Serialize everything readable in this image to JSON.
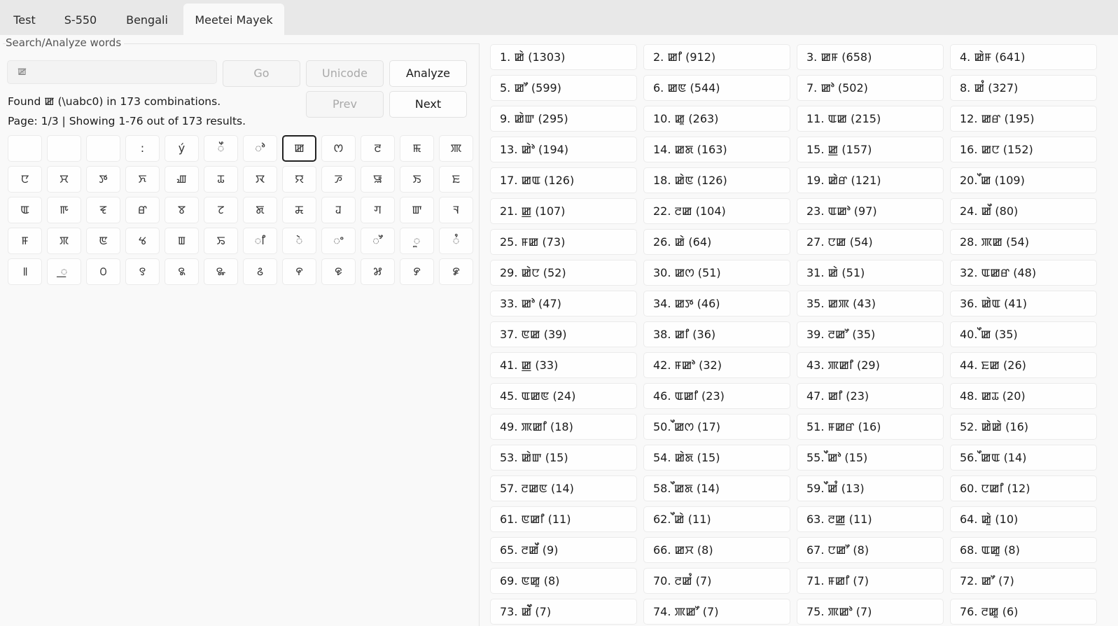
{
  "tabs": [
    {
      "label": "Test",
      "active": false
    },
    {
      "label": "S-550",
      "active": false
    },
    {
      "label": "Bengali",
      "active": false
    },
    {
      "label": "Meetei Mayek",
      "active": true
    }
  ],
  "panel": {
    "group_label": "Search/Analyze words",
    "search_value": "ꯀ",
    "go_label": "Go",
    "unicode_label": "Unicode",
    "analyze_label": "Analyze",
    "prev_label": "Prev",
    "next_label": "Next",
    "found_text": "Found ꯀ (\\uabc0) in 173 combinations.",
    "page_text": "Page: 1/3 | Showing 1-76 out of 173 results."
  },
  "keyboard": {
    "selected_index": 7,
    "keys": [
      "",
      "",
      "",
      ":",
      "ý",
      "ꯩ",
      "ꯣ",
      "ꯀ",
      "ꯁ",
      "ꯂ",
      "ꯃ",
      "ꯄ",
      "ꯅ",
      "ꯆ",
      "ꯇ",
      "ꯈ",
      "ꯉ",
      "ꯊ",
      "ꯋ",
      "ꯌ",
      "ꯍ",
      "ꯎ",
      "ꯏ",
      "ꯐ",
      "ꯑ",
      "ꯒ",
      "ꯓ",
      "ꯔ",
      "ꯕ",
      "ꯖ",
      "ꯗ",
      "ꯘ",
      "ꯙ",
      "ꯚ",
      "ꯛ",
      "ꯜ",
      "ꯝ",
      "ꯞ",
      "ꯟ",
      "ꯠ",
      "ꯡ",
      "ꯢ",
      "ꯤ",
      "ꯥ",
      "ꯦ",
      "ꯧ",
      "ꯨ",
      "ꯪ",
      "꯫",
      "꯭",
      "꯰",
      "꯱",
      "꯲",
      "꯳",
      "꯴",
      "꯵",
      "꯶",
      "꯷",
      "꯸",
      "꯹"
    ]
  },
  "results": [
    "1. ꯀꯥ (1303)",
    "2. ꯀꯤ (912)",
    "3. ꯀꯝ (658)",
    "4. ꯀꯥꯝ (641)",
    "5. ꯀꯧ (599)",
    "6. ꯀꯟ (544)",
    "7. ꯀꯣ (502)",
    "8. ꯀꯪ (327)",
    "9. ꯀꯥꯛ (295)",
    "10. ꯀꯨ (263)",
    "11. ꯑꯀ (215)",
    "12. ꯀꯔ (195)",
    "13. ꯀꯥꯣ (194)",
    "14. ꯀꯗ (163)",
    "15. ꯀ꯭ (157)",
    "16. ꯀꯅ (152)",
    "17. ꯀꯑ (126)",
    "18. ꯀꯥꯟ (126)",
    "19. ꯀꯥꯔ (121)",
    "20. ꯩꯀ (109)",
    "21. ꯀ꯭ (107)",
    "22. ꯂꯀ (104)",
    "23. ꯑꯀꯣ (97)",
    "24. ꯀꯩ (80)",
    "25. ꯝꯀ (73)",
    "26. ꯀꯥ (64)",
    "27. ꯅꯀ (54)",
    "28. ꯄꯀ (54)",
    "29. ꯀꯥꯅ (52)",
    "30. ꯀꯁ (51)",
    "31. ꯀꯥ (51)",
    "32. ꯑꯀꯔ (48)",
    "33. ꯀꯣ (47)",
    "34. ꯀꯇ (46)",
    "35. ꯀꯄ (43)",
    "36. ꯀꯥꯑ (41)",
    "37. ꯟꯀ (39)",
    "38. ꯀꯤ (36)",
    "39. ꯂꯀꯧ (35)",
    "40. ꯩꯀ (35)",
    "41. ꯀ꯭ (33)",
    "42. ꯝꯀꯣ (32)",
    "43. ꯄꯀꯤ (29)",
    "44. ꯐꯀ (26)",
    "45. ꯑꯀꯟ (24)",
    "46. ꯑꯀꯤ (23)",
    "47. ꯀꯤ (23)",
    "48. ꯀꯊ (20)",
    "49. ꯄꯀꯤ (18)",
    "50. ꯩꯀꯁ (17)",
    "51. ꯝꯀꯔ (16)",
    "52. ꯀꯥꯀꯥ (16)",
    "53. ꯀꯥꯛ (15)",
    "54. ꯀꯥꯗ (15)",
    "55. ꯩꯀꯣ (15)",
    "56. ꯩꯀꯑ (14)",
    "57. ꯂꯀꯟ (14)",
    "58. ꯩꯀꯗ (14)",
    "59. ꯩꯀꯪ (13)",
    "60. ꯅꯀꯤ (12)",
    "61. ꯟꯀꯤ (11)",
    "62. ꯩꯀꯥ (11)",
    "63. ꯂꯀ꯭ (11)",
    "64. ꯀꯥꯨ (10)",
    "65. ꯂꯀꯩ (9)",
    "66. ꯀꯆ (8)",
    "67. ꯅꯀꯧ (8)",
    "68. ꯑꯀꯨ (8)",
    "69. ꯟꯀꯨ (8)",
    "70. ꯂꯀꯪ (7)",
    "71. ꯝꯀꯤ (7)",
    "72. ꯀꯧ (7)",
    "73. ꯀꯥꯩ (7)",
    "74. ꯄꯀꯧ (7)",
    "75. ꯄꯀꯣ (7)",
    "76. ꯂꯀꯨ (6)"
  ]
}
